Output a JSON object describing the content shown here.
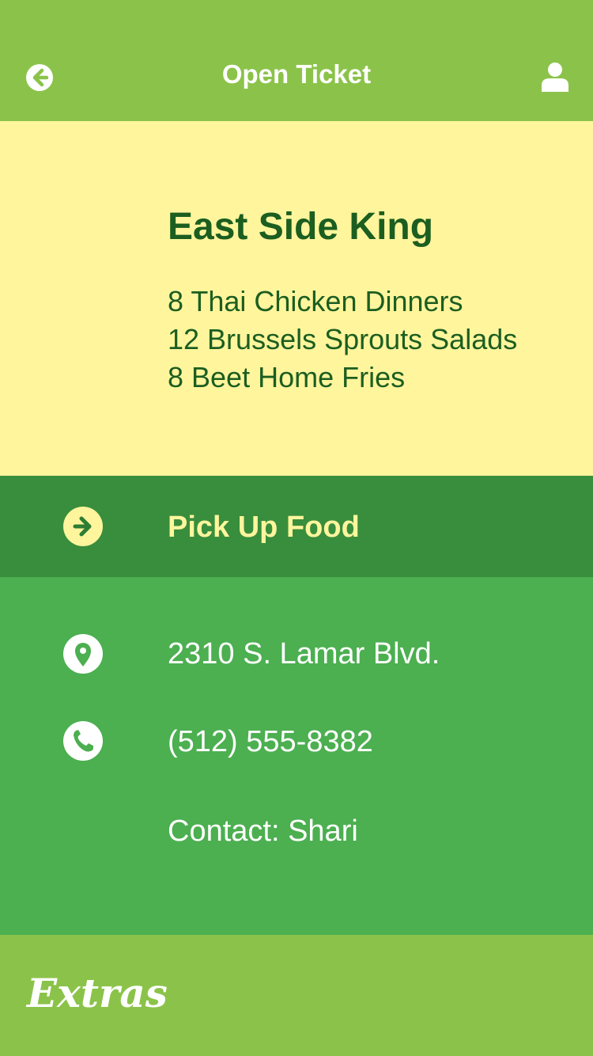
{
  "header": {
    "title": "Open Ticket",
    "back_icon": "arrow-left-circle-icon",
    "user_icon": "user-icon"
  },
  "order": {
    "restaurant": "East Side King",
    "items": [
      "8 Thai Chicken Dinners",
      "12 Brussels Sprouts Salads",
      "8 Beet Home Fries"
    ]
  },
  "action": {
    "label": "Pick Up Food",
    "icon": "arrow-right-circle-icon"
  },
  "details": {
    "address": "2310 S. Lamar Blvd.",
    "address_icon": "map-pin-icon",
    "phone": "(512) 555-8382",
    "phone_icon": "phone-icon",
    "contact": "Contact: Shari"
  },
  "footer": {
    "label": "Extras"
  },
  "colors": {
    "header_bg": "#8bc34a",
    "order_bg": "#fff59d",
    "order_text": "#1b5e20",
    "action_bg": "#388e3c",
    "action_text": "#fff59d",
    "details_bg": "#4caf50",
    "text_light": "#ffffff"
  }
}
